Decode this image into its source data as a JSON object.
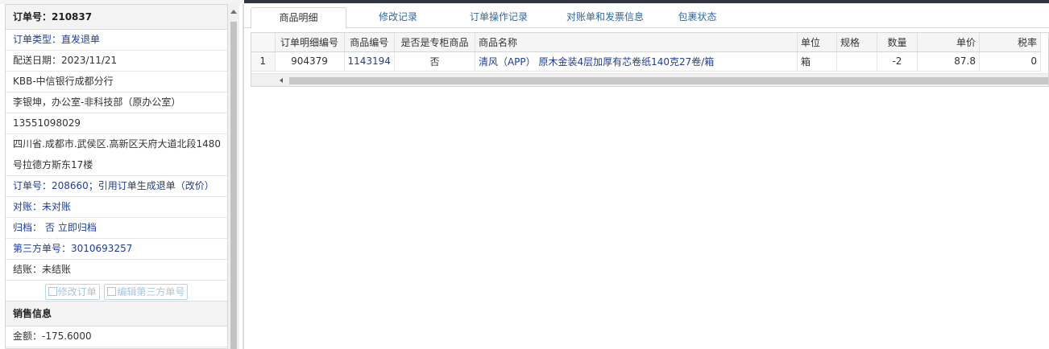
{
  "order": {
    "title": "订单号：210837",
    "type_label": "订单类型：",
    "type_value": "直发退单",
    "delivery_date": "配送日期：2023/11/21",
    "customer": "KBB-中信银行成都分行",
    "contact": "李银坤，办公室-非科技部（原办公室）",
    "phone": "13551098029",
    "address_line1": "四川省.成都市.武侯区.高新区天府大道北段1480",
    "address_line2": "号拉德方斯东17楼",
    "source_order": "订单号：208660；引用订单生成退单（改价）",
    "reconcile": "对账：未对账",
    "archive_label": "归档：",
    "archive_value": "否 立即归档",
    "third_party": "第三方单号：3010693257",
    "settlement": "结账：未结账",
    "edit_order_button": "修改订单",
    "edit_third_party_button": "编辑第三方单号"
  },
  "sales": {
    "title": "销售信息",
    "amount": "金额：-175.6000"
  },
  "tabs": [
    "商品明细",
    "修改记录",
    "订单操作记录",
    "对账单和发票信息",
    "包裹状态"
  ],
  "table": {
    "headers": [
      "订单明细编号",
      "商品编号",
      "是否是专柜商品",
      "商品名称",
      "单位",
      "规格",
      "数量",
      "单价",
      "税率"
    ],
    "rows": [
      {
        "index": "1",
        "detail_id": "904379",
        "product_id": "1143194",
        "is_counter": "否",
        "name": "清风（APP） 原木金装4层加厚有芯卷纸140克27卷/箱",
        "unit": "箱",
        "spec": "",
        "qty": "-2",
        "price": "87.8",
        "tax": "0"
      }
    ]
  }
}
